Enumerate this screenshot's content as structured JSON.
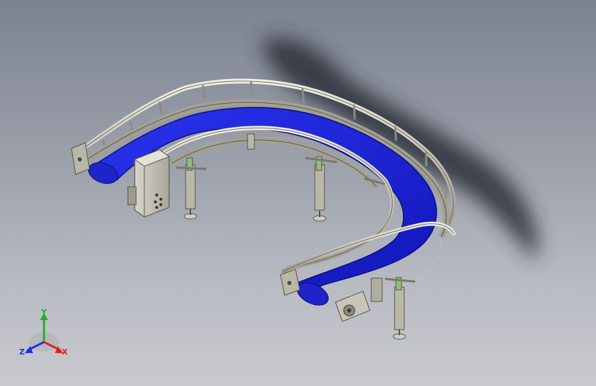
{
  "triad": {
    "x_label": "X",
    "y_label": "Y",
    "z_label": "Z"
  },
  "colors": {
    "belt": "#1a22d8",
    "frame": "#b9b8a8",
    "rail": "#d6d3c6",
    "shadow": "#2a2e38",
    "background_top": "#7d8290",
    "background_bottom": "#c8cace",
    "axis_x": "#e02020",
    "axis_y": "#22b022",
    "axis_z": "#2030e0"
  },
  "icons": {
    "triad": "xyz-triad-icon",
    "motor": "drive-motor-icon"
  }
}
